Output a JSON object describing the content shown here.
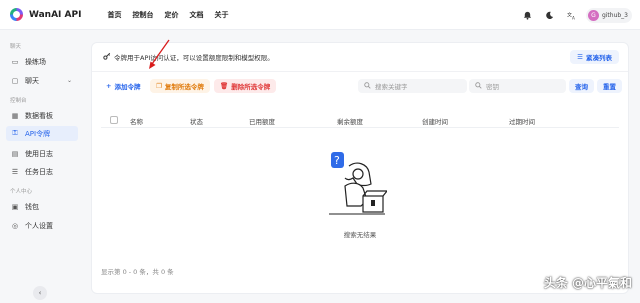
{
  "app": {
    "name": "WanAI API"
  },
  "nav": [
    "首页",
    "控制台",
    "定价",
    "文档",
    "关于"
  ],
  "user": {
    "avatar_letter": "G",
    "name": "github_3"
  },
  "sidebar": {
    "section_chat": "聊天",
    "playground": "操练场",
    "chat": "聊天",
    "section_console": "控制台",
    "dashboard": "数据看板",
    "api_tokens": "API令牌",
    "usage_logs": "使用日志",
    "task_logs": "任务日志",
    "section_personal": "个人中心",
    "wallet": "钱包",
    "personal_settings": "个人设置"
  },
  "main": {
    "info_text": "令牌用于API访问认证，可以设置额度限制和模型权限。",
    "compact_label": "紧凑列表",
    "add_token": "添加令牌",
    "copy_selected": "复制所选令牌",
    "delete_selected": "删除所选令牌",
    "search_keyword_placeholder": "搜索关键字",
    "search_key_placeholder": "密钥",
    "query_label": "查询",
    "reset_label": "重置",
    "columns": [
      "名称",
      "状态",
      "已用额度",
      "剩余额度",
      "创建时间",
      "过期时间"
    ],
    "empty_text": "搜索无结果",
    "pagination": "显示第 0 - 0 条，共 0 条"
  },
  "watermark": "头条 @心平氣和",
  "colors": {
    "accent": "#2563eb",
    "copy": "#e07b0c",
    "delete": "#e03a3a",
    "annotation_arrow": "#d91c1c"
  }
}
